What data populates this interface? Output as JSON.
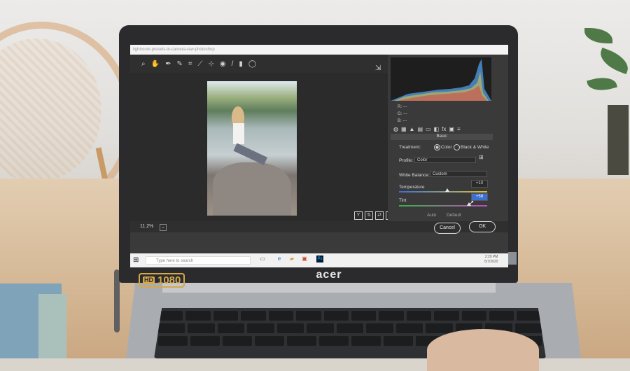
{
  "laptop": {
    "brand": "acer",
    "badge_hd": "HD",
    "badge_resolution": "1080"
  },
  "app": {
    "title_bar": "lightroom-presets-in-camera-raw-photoshop",
    "zoom_level": "11.2%",
    "toolbar_icons": [
      "zoom-icon",
      "hand-icon",
      "white-balance-icon",
      "color-sampler-icon",
      "crop-icon",
      "straighten-icon",
      "spot-removal-icon",
      "red-eye-icon",
      "adjustment-brush-icon",
      "graduated-filter-icon",
      "radial-filter-icon"
    ],
    "rgb_readout": {
      "r_label": "R:",
      "r_value": "---",
      "g_label": "G:",
      "g_value": "---",
      "b_label": "B:",
      "b_value": "---"
    },
    "panel_tabs": [
      "basic-icon",
      "tone-curve-icon",
      "detail-icon",
      "hsl-icon",
      "split-toning-icon",
      "lens-icon",
      "effects-icon",
      "calibration-icon",
      "presets-icon"
    ],
    "section_title": "Basic",
    "treatment": {
      "label": "Treatment:",
      "options": [
        "Color",
        "Black & White"
      ],
      "selected": "Color"
    },
    "profile": {
      "label": "Profile:",
      "value": "Color"
    },
    "white_balance": {
      "label": "White Balance:",
      "value": "Custom"
    },
    "temperature": {
      "label": "Temperature",
      "value": "+10",
      "level": 0.55
    },
    "tint": {
      "label": "Tint",
      "value": "+58",
      "level": 0.79
    },
    "auto_label": "Auto",
    "default_label": "Default",
    "cancel_label": "Cancel",
    "ok_label": "OK"
  },
  "taskbar": {
    "search_placeholder": "Type here to search",
    "time": "2:20 PM",
    "date": "5/7/2020"
  },
  "colors": {
    "temperature_gradient": [
      "#3b6fd4",
      "#d9c23c"
    ],
    "tint_gradient": [
      "#3bb04a",
      "#c04ac0"
    ],
    "accent": "#3d6fd6"
  }
}
